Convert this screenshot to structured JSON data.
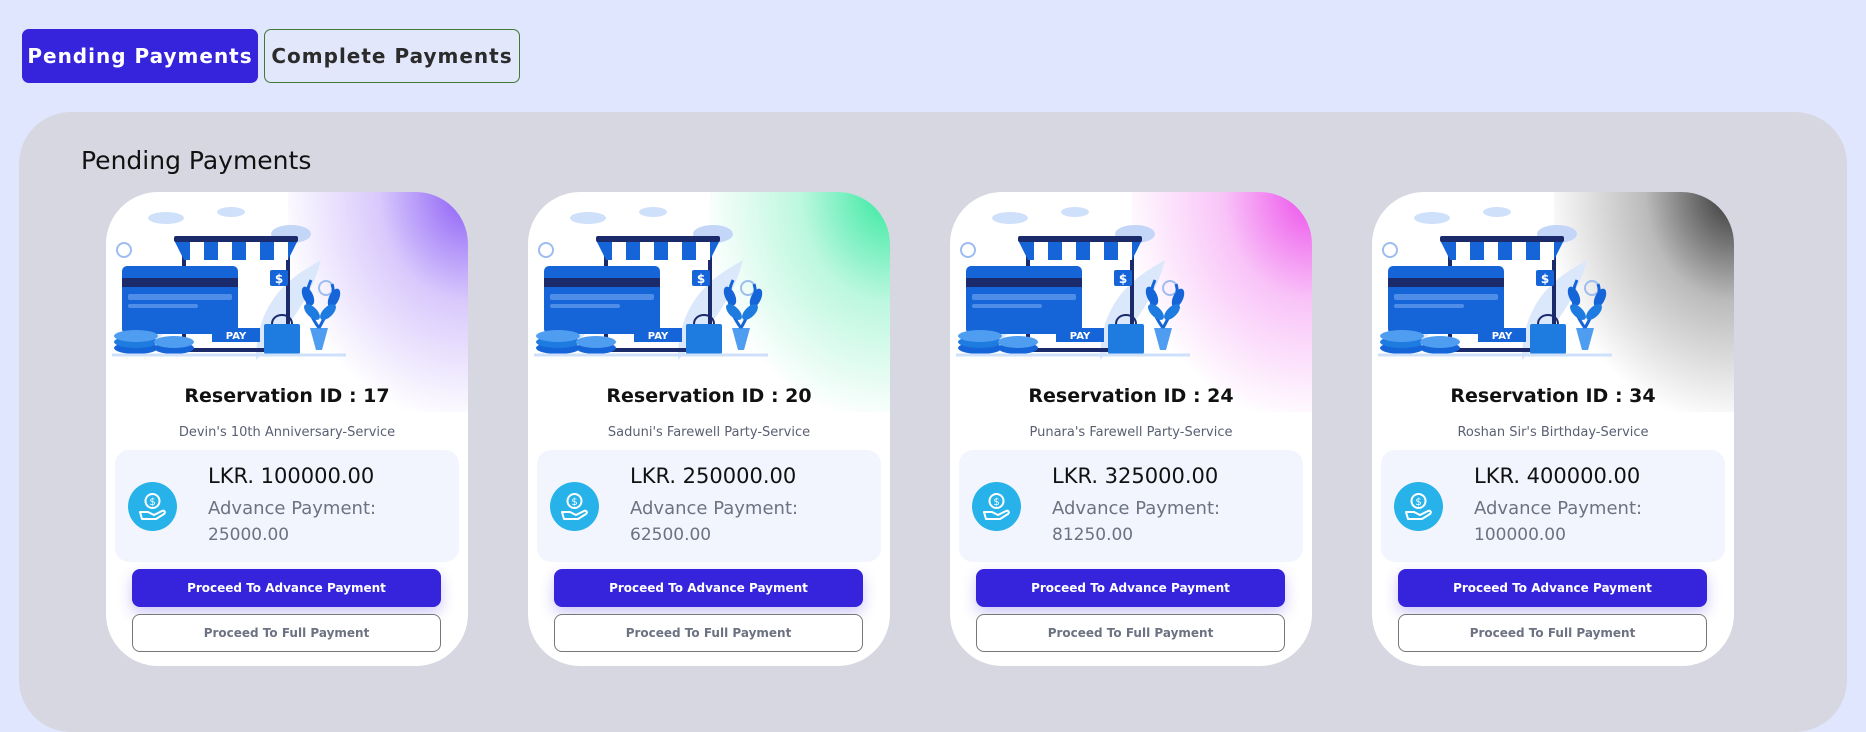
{
  "tabs": {
    "pending_label": "Pending Payments",
    "complete_label": "Complete Payments"
  },
  "section_title": "Pending Payments",
  "illustration_label": "PAY",
  "cards": [
    {
      "reservation": "Reservation ID : 17",
      "service": "Devin's 10th Anniversary-Service",
      "amount": "LKR. 100000.00",
      "advance_label": "Advance Payment:",
      "advance_value": "25000.00",
      "advance_button": "Proceed To Advance Payment",
      "full_button": "Proceed To Full Payment",
      "accent": "#8b5cf6"
    },
    {
      "reservation": "Reservation ID : 20",
      "service": "Saduni's Farewell Party-Service",
      "amount": "LKR. 250000.00",
      "advance_label": "Advance Payment:",
      "advance_value": "62500.00",
      "advance_button": "Proceed To Advance Payment",
      "full_button": "Proceed To Full Payment",
      "accent": "#34e89e"
    },
    {
      "reservation": "Reservation ID : 24",
      "service": "Punara's Farewell Party-Service",
      "amount": "LKR. 325000.00",
      "advance_label": "Advance Payment:",
      "advance_value": "81250.00",
      "advance_button": "Proceed To Advance Payment",
      "full_button": "Proceed To Full Payment",
      "accent": "#ec4dea"
    },
    {
      "reservation": "Reservation ID : 34",
      "service": "Roshan Sir's Birthday-Service",
      "amount": "LKR. 400000.00",
      "advance_label": "Advance Payment:",
      "advance_value": "100000.00",
      "advance_button": "Proceed To Advance Payment",
      "full_button": "Proceed To Full Payment",
      "accent": "#333333"
    }
  ],
  "colors": {
    "primary": "#3624dd",
    "page_bg": "#e0e6fd",
    "panel_bg": "#d7d7e2",
    "icon_cyan": "#27b3ea"
  },
  "icons": [
    "credit-card-illustration",
    "storefront-awning-illustration",
    "dollar-tag-icon",
    "plant-icon",
    "coin-stack-icon",
    "shopping-bag-icon",
    "hand-coin-icon"
  ]
}
